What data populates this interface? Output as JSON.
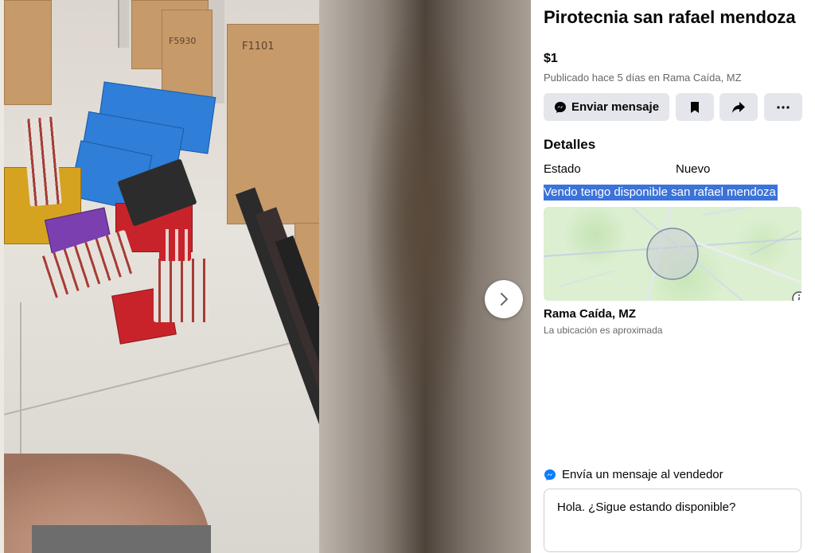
{
  "listing": {
    "title": "Pirotecnia san rafael mendoza",
    "price": "$1",
    "posted": "Publicado hace 5 días en Rama Caída, MZ"
  },
  "actions": {
    "message_label": "Enviar mensaje"
  },
  "details": {
    "heading": "Detalles",
    "condition_label": "Estado",
    "condition_value": "Nuevo",
    "description": "Vendo tengo disponible san rafael mendoza"
  },
  "location": {
    "name": "Rama Caída, MZ",
    "note": "La ubicación es aproximada"
  },
  "seller_message": {
    "heading": "Envía un mensaje al vendedor",
    "text": "Hola. ¿Sigue estando disponible?"
  },
  "photo": {
    "carton_label_1": "F1101",
    "carton_label_2": "F5930"
  },
  "icons": {
    "next": "chevron-right-icon",
    "messenger": "messenger-icon",
    "save": "bookmark-icon",
    "share": "share-icon",
    "more": "more-icon",
    "info": "info-icon"
  },
  "colors": {
    "button_bg": "#e4e6eb",
    "secondary_text": "#65676b",
    "messenger_blue": "#0a7cff",
    "selection_highlight": "#3b73d9"
  }
}
